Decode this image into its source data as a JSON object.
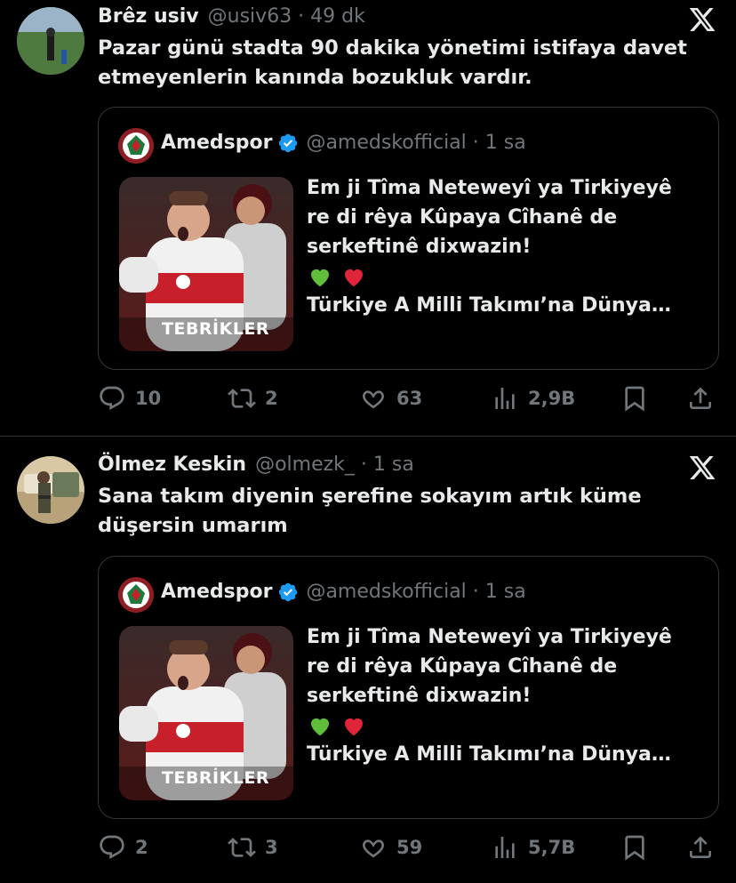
{
  "tweets": [
    {
      "name": "Brêz usiv",
      "handle": "@usiv63 · 49 dk",
      "text": "Pazar günü stadta 90 dakika yönetimi istifaya davet etmeyenlerin kanında bozukluk vardır.",
      "quote": {
        "name": "Amedspor",
        "handle": "@amedskofficial · 1 sa",
        "text": "Em ji Tîma Neteweyî ya Tirkiyeyê re di rêya Kûpaya Cîhanê de serkeftinê dixwazin!",
        "text2": "Türkiye A Milli Takımı’na Dünya…",
        "image_caption": "TEBRİKLER"
      },
      "stats": {
        "replies": "10",
        "reposts": "2",
        "likes": "63",
        "views": "2,9B"
      }
    },
    {
      "name": "Ölmez Keskin",
      "handle": "@olmezk_ · 1 sa",
      "text": "Sana takım diyenin şerefine sokayım artık küme düşersin umarım",
      "quote": {
        "name": "Amedspor",
        "handle": "@amedskofficial · 1 sa",
        "text": "Em ji Tîma Neteweyî ya Tirkiyeyê re di rêya Kûpaya Cîhanê de serkeftinê dixwazin!",
        "text2": "Türkiye A Milli Takımı’na Dünya…",
        "image_caption": "TEBRİKLER"
      },
      "stats": {
        "replies": "2",
        "reposts": "3",
        "likes": "59",
        "views": "5,7B"
      }
    }
  ],
  "colors": {
    "background": "#000000",
    "text": "#e7e9ea",
    "muted": "#71767b",
    "verified": "#1d9bf0",
    "border": "#333639"
  },
  "icons": [
    "x-logo-icon",
    "verified-badge-icon",
    "reply-icon",
    "repost-icon",
    "like-icon",
    "views-icon",
    "bookmark-icon",
    "share-icon",
    "green-heart-icon",
    "red-heart-icon"
  ]
}
